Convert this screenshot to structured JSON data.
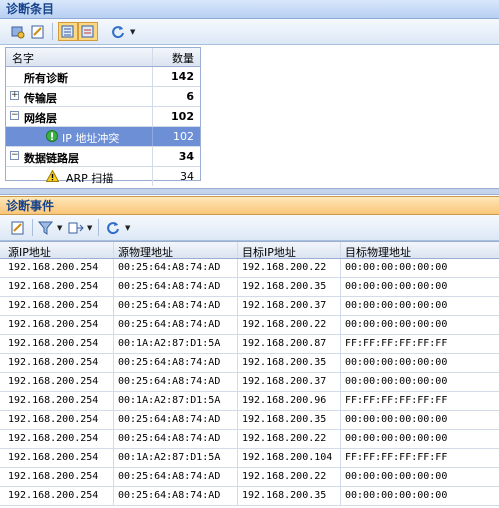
{
  "top_panel": {
    "title": "诊断条目",
    "tree": {
      "headers": {
        "name": "名字",
        "count": "数量"
      },
      "rows": [
        {
          "name": "所有诊断",
          "count": "142"
        },
        {
          "name": "传输层",
          "count": "6",
          "expander": "+"
        },
        {
          "name": "网络层",
          "count": "102",
          "expander": "−"
        },
        {
          "name": "IP 地址冲突",
          "count": "102"
        },
        {
          "name": "数据链路层",
          "count": "34",
          "expander": "−"
        },
        {
          "name": "ARP 扫描",
          "count": "34"
        }
      ]
    }
  },
  "bottom_panel": {
    "title": "诊断事件",
    "table": {
      "headers": [
        "源IP地址",
        "源物理地址",
        "目标IP地址",
        "目标物理地址"
      ],
      "rows": [
        [
          "192.168.200.254",
          "00:25:64:A8:74:AD",
          "192.168.200.22",
          "00:00:00:00:00:00"
        ],
        [
          "192.168.200.254",
          "00:25:64:A8:74:AD",
          "192.168.200.35",
          "00:00:00:00:00:00"
        ],
        [
          "192.168.200.254",
          "00:25:64:A8:74:AD",
          "192.168.200.37",
          "00:00:00:00:00:00"
        ],
        [
          "192.168.200.254",
          "00:25:64:A8:74:AD",
          "192.168.200.22",
          "00:00:00:00:00:00"
        ],
        [
          "192.168.200.254",
          "00:1A:A2:87:D1:5A",
          "192.168.200.87",
          "FF:FF:FF:FF:FF:FF"
        ],
        [
          "192.168.200.254",
          "00:25:64:A8:74:AD",
          "192.168.200.35",
          "00:00:00:00:00:00"
        ],
        [
          "192.168.200.254",
          "00:25:64:A8:74:AD",
          "192.168.200.37",
          "00:00:00:00:00:00"
        ],
        [
          "192.168.200.254",
          "00:1A:A2:87:D1:5A",
          "192.168.200.96",
          "FF:FF:FF:FF:FF:FF"
        ],
        [
          "192.168.200.254",
          "00:25:64:A8:74:AD",
          "192.168.200.35",
          "00:00:00:00:00:00"
        ],
        [
          "192.168.200.254",
          "00:25:64:A8:74:AD",
          "192.168.200.22",
          "00:00:00:00:00:00"
        ],
        [
          "192.168.200.254",
          "00:1A:A2:87:D1:5A",
          "192.168.200.104",
          "FF:FF:FF:FF:FF:FF"
        ],
        [
          "192.168.200.254",
          "00:25:64:A8:74:AD",
          "192.168.200.22",
          "00:00:00:00:00:00"
        ],
        [
          "192.168.200.254",
          "00:25:64:A8:74:AD",
          "192.168.200.35",
          "00:00:00:00:00:00"
        ]
      ]
    }
  },
  "colors": {
    "accent_blue": "#15428b",
    "selection": "#6d8fd6",
    "header_orange": "#f9c679"
  }
}
